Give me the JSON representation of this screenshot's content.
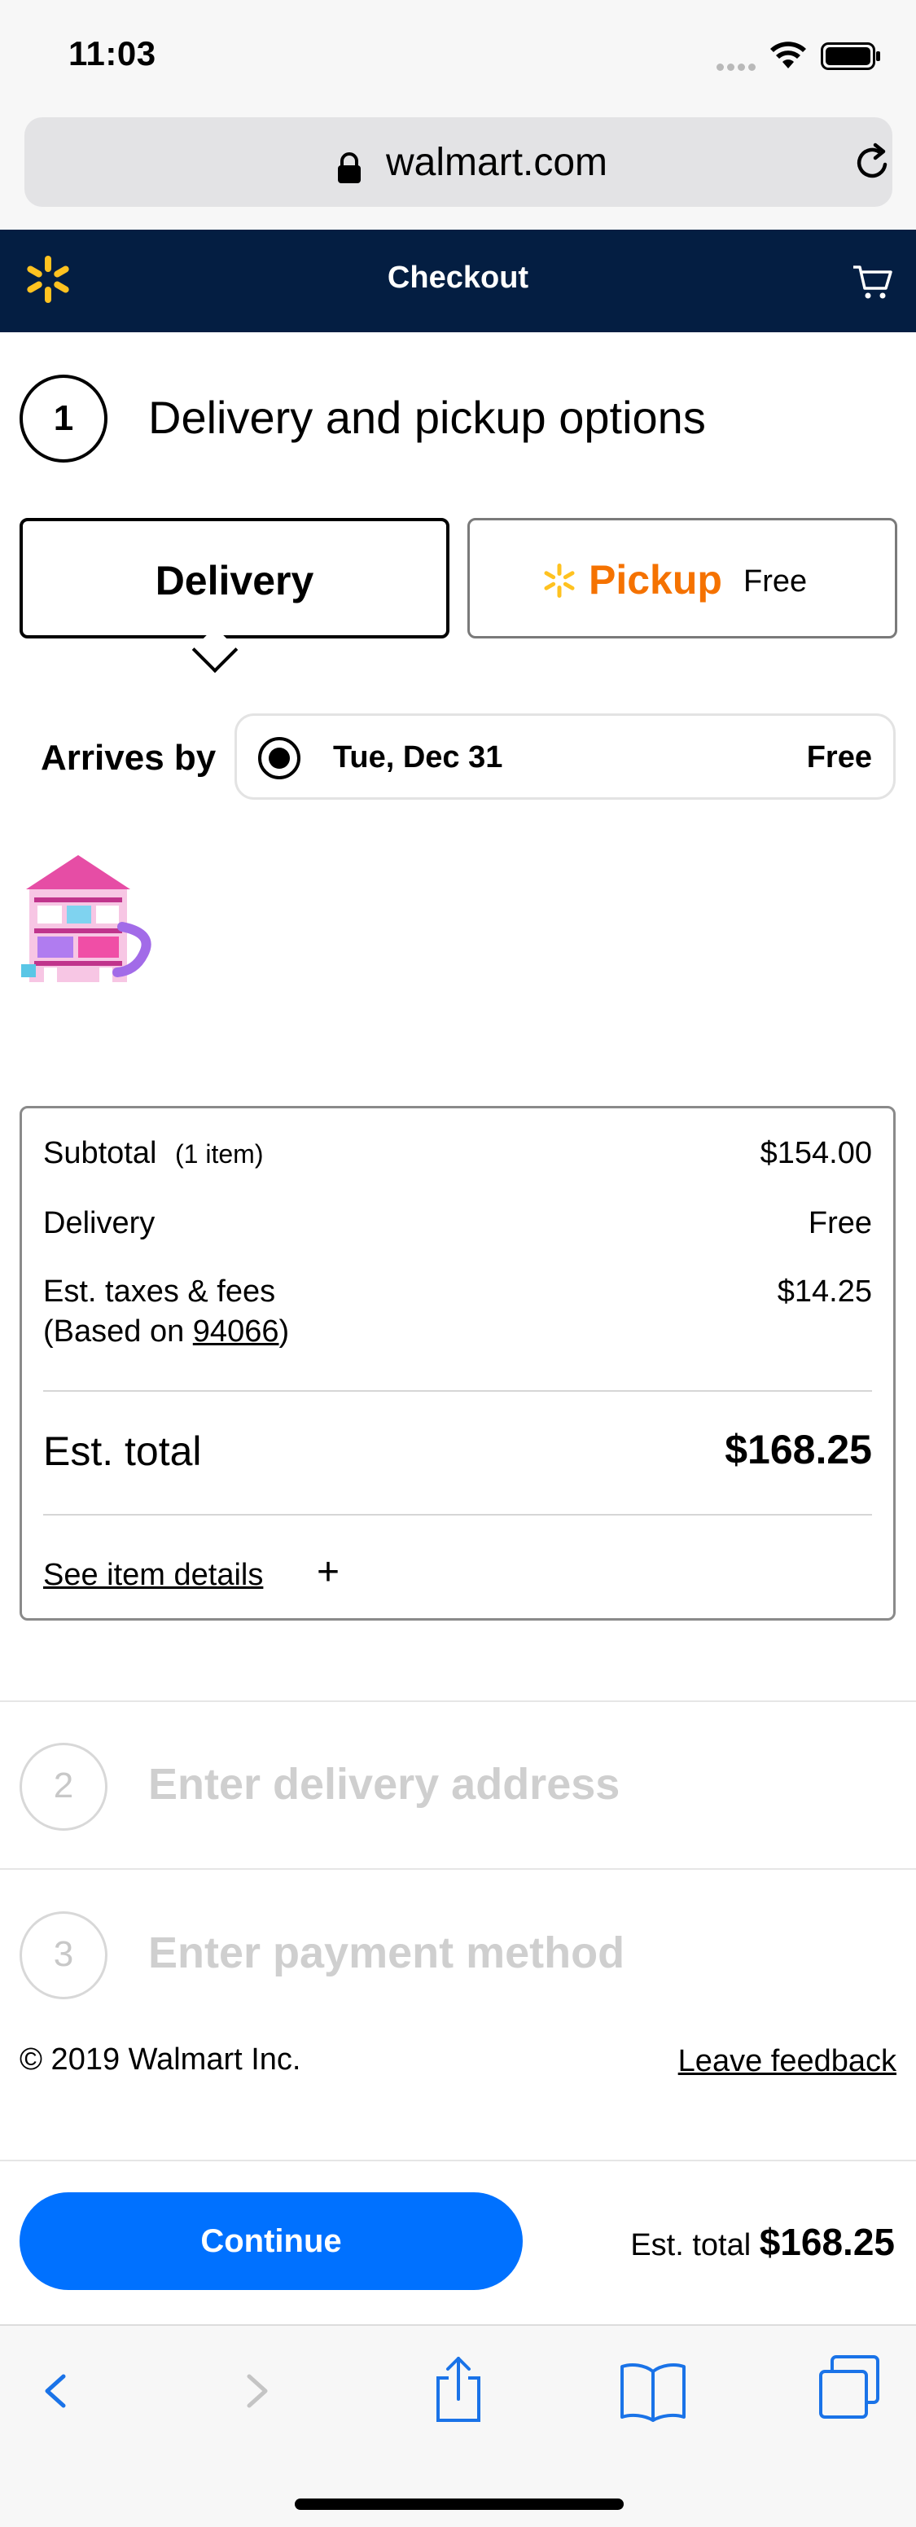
{
  "status_bar": {
    "time": "11:03"
  },
  "browser": {
    "url": "walmart.com"
  },
  "header": {
    "title": "Checkout",
    "brand_color": "#041e42",
    "spark_color": "#ffc220"
  },
  "step1": {
    "number": "1",
    "title": "Delivery and pickup options",
    "delivery_label": "Delivery",
    "pickup_label": "Pickup",
    "pickup_price": "Free",
    "arrives_label": "Arrives by",
    "date_option": {
      "date": "Tue, Dec 31",
      "price": "Free",
      "selected": true
    }
  },
  "summary": {
    "subtotal_label": "Subtotal",
    "subtotal_items": "(1 item)",
    "subtotal_value": "$154.00",
    "delivery_label": "Delivery",
    "delivery_value": "Free",
    "tax_label": "Est. taxes & fees",
    "tax_based_prefix": "(Based on ",
    "tax_zip": "94066",
    "tax_based_suffix": ")",
    "tax_value": "$14.25",
    "total_label": "Est. total",
    "total_value": "$168.25",
    "details_link": "See item details"
  },
  "step2": {
    "number": "2",
    "title": "Enter delivery address"
  },
  "step3": {
    "number": "3",
    "title": "Enter payment method"
  },
  "footer": {
    "copyright": "© 2019 Walmart Inc.",
    "feedback": "Leave feedback"
  },
  "bottom_bar": {
    "continue_label": "Continue",
    "total_label": "Est. total",
    "total_value": "$168.25",
    "button_color": "#0071ff"
  },
  "toolbar": {
    "icons": [
      "back-icon",
      "forward-icon",
      "share-icon",
      "bookmarks-icon",
      "tabs-icon"
    ],
    "tint": "#1a73e8"
  }
}
